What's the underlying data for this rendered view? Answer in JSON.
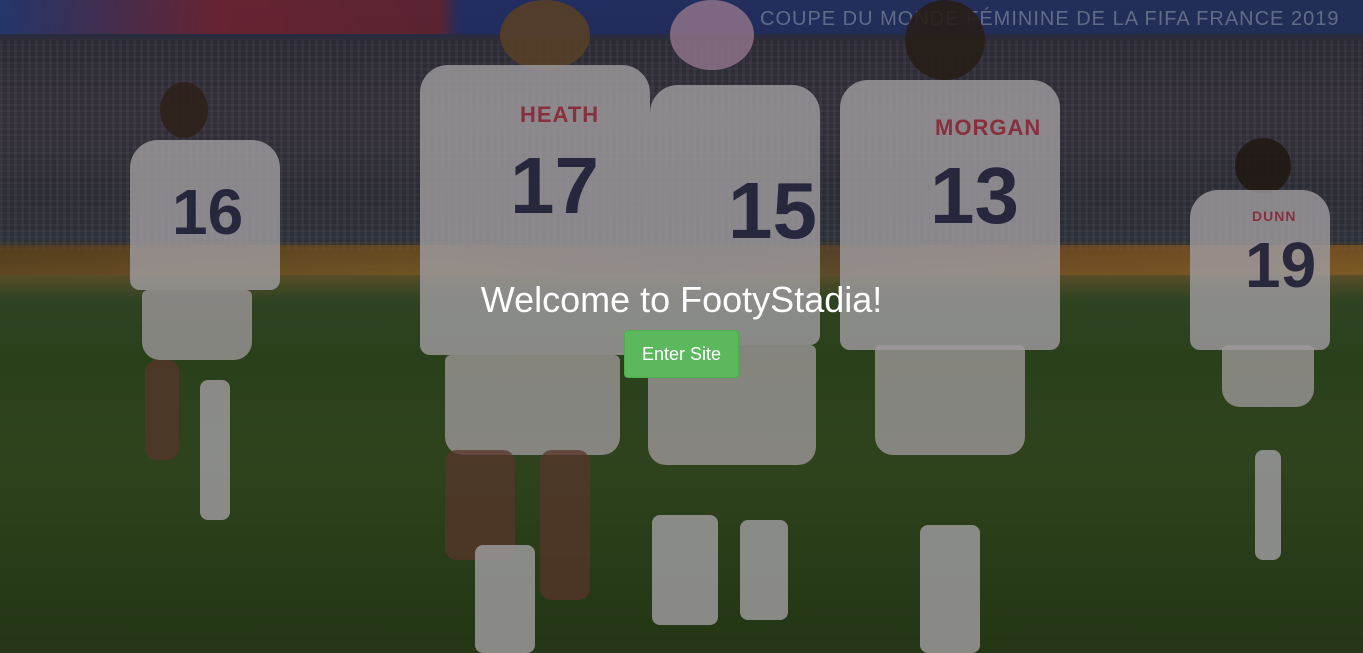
{
  "hero": {
    "background": {
      "banner_text": "COUPE DU MONDE FÉMININE DE LA FIFA FRANCE 2019",
      "players": [
        {
          "name": "HEATH",
          "number": "17"
        },
        {
          "name": "MORGAN",
          "number": "13"
        },
        {
          "name": "",
          "number": "15"
        },
        {
          "name": "",
          "number": "16"
        },
        {
          "name": "DUNN",
          "number": "19"
        }
      ]
    },
    "title": "Welcome to FootyStadia!",
    "enter_button_label": "Enter Site"
  },
  "colors": {
    "button_bg": "#5cb85c",
    "title_text": "#ffffff"
  }
}
